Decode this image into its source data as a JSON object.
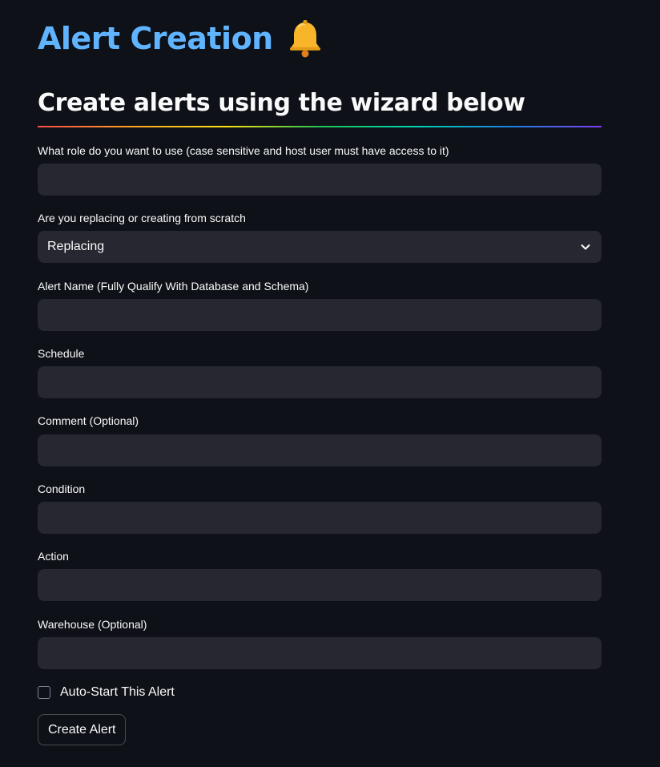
{
  "header": {
    "title": "Alert Creation",
    "title_icon": "bell-icon",
    "subtitle": "Create alerts using the wizard below"
  },
  "colors": {
    "background": "#0e1117",
    "title": "#60b4ff",
    "input_bg": "#262730",
    "text": "#fafafa"
  },
  "form": {
    "role": {
      "label": "What role do you want to use (case sensitive and host user must have access to it)",
      "value": "",
      "placeholder": ""
    },
    "mode": {
      "label": "Are you replacing or creating from scratch",
      "selected": "Replacing",
      "icon": "chevron-down-icon"
    },
    "alert_name": {
      "label": "Alert Name (Fully Qualify With Database and Schema)",
      "value": "",
      "placeholder": ""
    },
    "schedule": {
      "label": "Schedule",
      "value": "",
      "placeholder": ""
    },
    "comment": {
      "label": "Comment (Optional)",
      "value": "",
      "placeholder": ""
    },
    "condition": {
      "label": "Condition",
      "value": "",
      "placeholder": ""
    },
    "action": {
      "label": "Action",
      "value": "",
      "placeholder": ""
    },
    "warehouse": {
      "label": "Warehouse (Optional)",
      "value": "",
      "placeholder": ""
    },
    "auto_start": {
      "label": "Auto-Start This Alert",
      "checked": false
    },
    "submit_label": "Create Alert"
  }
}
